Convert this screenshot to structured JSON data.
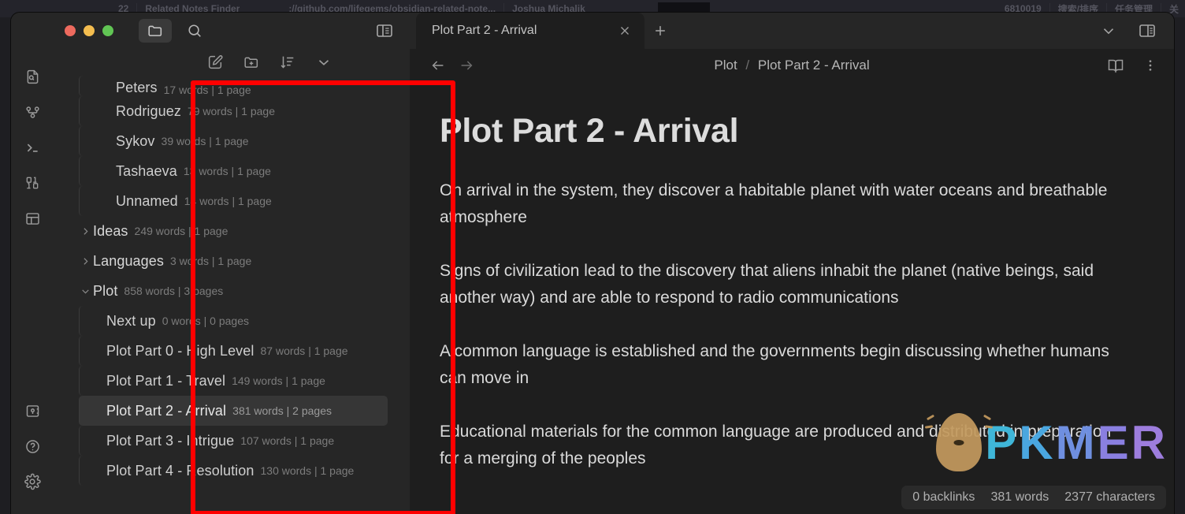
{
  "background_strip": {
    "items": [
      {
        "text": "22"
      },
      {
        "text": "Related Notes Finder"
      },
      {
        "text": "://github.com/lifegems/obsidian-related-note..."
      },
      {
        "text": "Joshua Michalik"
      },
      {
        "text": "6810019"
      },
      {
        "text": "搜索/排序"
      },
      {
        "text": "任务管理"
      },
      {
        "text": "关"
      }
    ]
  },
  "window_controls": {
    "close": "close-window",
    "minimize": "minimize-window",
    "maximize": "maximize-window"
  },
  "explorer_titlebar": {
    "folder_icon": "folder-icon",
    "search_icon": "search-icon",
    "sidebar_toggle_icon": "left-sidebar-toggle-icon"
  },
  "explorer_toolbar": {
    "new_note": "new-note-icon",
    "new_folder": "new-folder-icon",
    "sort": "sort-icon",
    "collapse": "collapse-all-icon"
  },
  "ribbon": {
    "items": [
      {
        "icon": "file-search-icon",
        "label": "Quick switcher"
      },
      {
        "icon": "graph-view-icon",
        "label": "Graph view"
      },
      {
        "icon": "terminal-icon",
        "label": "Terminal"
      },
      {
        "icon": "binary-icon",
        "label": "Binary"
      },
      {
        "icon": "layout-icon",
        "label": "Layout"
      }
    ],
    "bottom_items": [
      {
        "icon": "vault-icon",
        "label": "Open another vault"
      },
      {
        "icon": "help-icon",
        "label": "Help"
      },
      {
        "icon": "settings-gear-icon",
        "label": "Settings"
      }
    ]
  },
  "file_tree": [
    {
      "title": "Peters",
      "meta": "17 words | 1 page",
      "type": "file",
      "indent": 2,
      "selected": false,
      "clipped_top": true
    },
    {
      "title": "Rodriguez",
      "meta": "79 words | 1 page",
      "type": "file",
      "indent": 2,
      "selected": false
    },
    {
      "title": "Sykov",
      "meta": "39 words | 1 page",
      "type": "file",
      "indent": 2,
      "selected": false
    },
    {
      "title": "Tashaeva",
      "meta": "13 words | 1 page",
      "type": "file",
      "indent": 2,
      "selected": false
    },
    {
      "title": "Unnamed",
      "meta": "14 words | 1 page",
      "type": "file",
      "indent": 2,
      "selected": false
    },
    {
      "title": "Ideas",
      "meta": "249 words | 1 page",
      "type": "folder",
      "indent": 0,
      "expanded": false,
      "selected": false
    },
    {
      "title": "Languages",
      "meta": "3 words | 1 page",
      "type": "folder",
      "indent": 0,
      "expanded": false,
      "selected": false
    },
    {
      "title": "Plot",
      "meta": "858 words | 3 pages",
      "type": "folder",
      "indent": 0,
      "expanded": true,
      "selected": false
    },
    {
      "title": "Next up",
      "meta": "0 words | 0 pages",
      "type": "file",
      "indent": 1,
      "selected": false
    },
    {
      "title": "Plot Part 0 - High Level",
      "meta": "87 words | 1 page",
      "type": "file",
      "indent": 1,
      "selected": false
    },
    {
      "title": "Plot Part 1 - Travel",
      "meta": "149 words | 1 page",
      "type": "file",
      "indent": 1,
      "selected": false
    },
    {
      "title": "Plot Part 2 - Arrival",
      "meta": "381 words | 2 pages",
      "type": "file",
      "indent": 1,
      "selected": true
    },
    {
      "title": "Plot Part 3 - Intrigue",
      "meta": "107 words | 1 page",
      "type": "file",
      "indent": 1,
      "selected": false
    },
    {
      "title": "Plot Part 4 - Resolution",
      "meta": "130 words | 1 page",
      "type": "file",
      "indent": 1,
      "selected": false
    }
  ],
  "tabs": {
    "active": {
      "label": "Plot Part 2 - Arrival",
      "close_icon": "close-icon"
    },
    "new_tab_icon": "plus-icon",
    "right_icons": [
      {
        "icon": "chevron-down-icon"
      },
      {
        "icon": "right-sidebar-toggle-icon"
      }
    ]
  },
  "view_header": {
    "back_icon": "arrow-left-icon",
    "forward_icon": "arrow-right-icon",
    "breadcrumb_parent": "Plot",
    "breadcrumb_separator": "/",
    "breadcrumb_current": "Plot Part 2 - Arrival",
    "reading_view_icon": "book-open-icon",
    "more_options_icon": "more-vertical-icon"
  },
  "note": {
    "title": "Plot Part 2 - Arrival",
    "paragraphs": [
      "On arrival in the system, they discover a habitable planet with water oceans and breathable atmosphere",
      "Signs of civilization lead to the discovery that aliens inhabit the planet (native beings, said another way) and are able to respond to radio communications",
      "A common language is established and the governments begin discussing whether humans can move in",
      "Educational materials for the common language are produced and distributed in preparation for a merging of the peoples"
    ]
  },
  "status_bar": {
    "backlinks": "0 backlinks",
    "words": "381 words",
    "characters": "2377 characters"
  },
  "watermark": {
    "letters": [
      "P",
      "K",
      "M",
      "E",
      "R"
    ],
    "logo": "pkmer-egg-logo"
  },
  "annotation": {
    "highlight_color": "#ff0000",
    "shape": "rectangle"
  }
}
